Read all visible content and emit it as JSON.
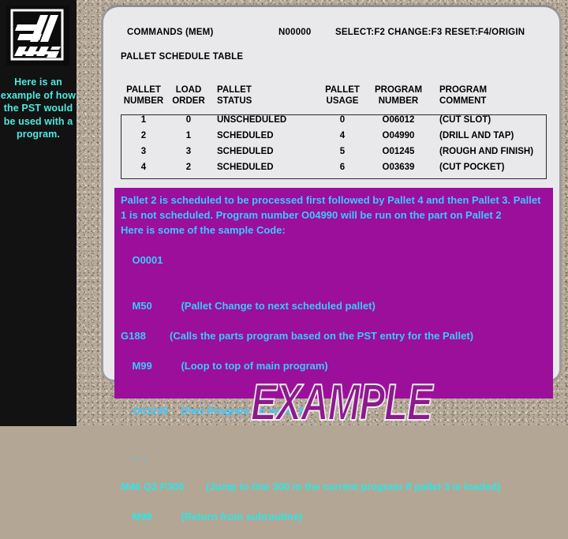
{
  "sidebar": {
    "logo_name": "HAAS",
    "caption": "Here is an example of how the PST would be used with a program."
  },
  "panel": {
    "commands_label": "COMMANDS (MEM)",
    "n_number": "N00000",
    "function_keys": "SELECT:F2  CHANGE:F3  RESET:F4/ORIGIN",
    "table_title": "PALLET SCHEDULE TABLE"
  },
  "table": {
    "headers": [
      {
        "line1": "PALLET",
        "line2": "NUMBER"
      },
      {
        "line1": "LOAD",
        "line2": "ORDER"
      },
      {
        "line1": "PALLET",
        "line2": "STATUS"
      },
      {
        "line1": "PALLET",
        "line2": "USAGE"
      },
      {
        "line1": "PROGRAM",
        "line2": "NUMBER"
      },
      {
        "line1": "PROGRAM",
        "line2": "COMMENT"
      }
    ],
    "rows": [
      {
        "pallet_number": "1",
        "load_order": "0",
        "pallet_status": "UNSCHEDULED",
        "pallet_usage": "0",
        "program_number": "O06012",
        "program_comment": "(CUT SLOT)"
      },
      {
        "pallet_number": "2",
        "load_order": "1",
        "pallet_status": "SCHEDULED",
        "pallet_usage": "4",
        "program_number": "O04990",
        "program_comment": "(DRILL AND TAP)"
      },
      {
        "pallet_number": "3",
        "load_order": "3",
        "pallet_status": "SCHEDULED",
        "pallet_usage": "5",
        "program_number": "O01245",
        "program_comment": "(ROUGH AND FINISH)"
      },
      {
        "pallet_number": "4",
        "load_order": "2",
        "pallet_status": "SCHEDULED",
        "pallet_usage": "6",
        "program_number": "O03639",
        "program_comment": "(CUT POCKET)"
      }
    ]
  },
  "narrative": {
    "para1": "Pallet 2 is scheduled to be processed first followed by Pallet 4 and then Pallet 3.  Pallet 1 is not scheduled.  Program number O04990 will be run on the part on Pallet 2",
    "sample_intro": "Here is some of the sample Code:",
    "code": [
      {
        "op": "O0001",
        "comment": ""
      },
      {
        "op": "M50",
        "comment": "(Pallet Change to next scheduled pallet)"
      },
      {
        "op": "G188",
        "comment": "(Calls the parts program based on the PST entry for the Pallet)"
      },
      {
        "op": "M99",
        "comment": "(Loop to top of main program)"
      },
      {
        "op": "O01245",
        "comment": "(Part Program for pallet 3)"
      },
      {
        "op": ". . .",
        "comment": ""
      },
      {
        "op": "M46 Q3 P300",
        "comment": "(Jump to line 300 in the current program if pallet 3 is loaded)"
      },
      {
        "op": "M99",
        "comment": "(Return from subroutine)"
      }
    ]
  },
  "watermark": {
    "text": "EXAMPLE"
  },
  "colors": {
    "sidebar_bg": "#121212",
    "sidebar_text": "#4fe8e0",
    "panel_bg": "#e9e9ec",
    "purple_box": "#9b0f9b",
    "purple_text": "#3cc8ff",
    "overflow_text": "#2fe6e6",
    "watermark": "#8d1a8d",
    "stone_bg": "#b5a897"
  }
}
